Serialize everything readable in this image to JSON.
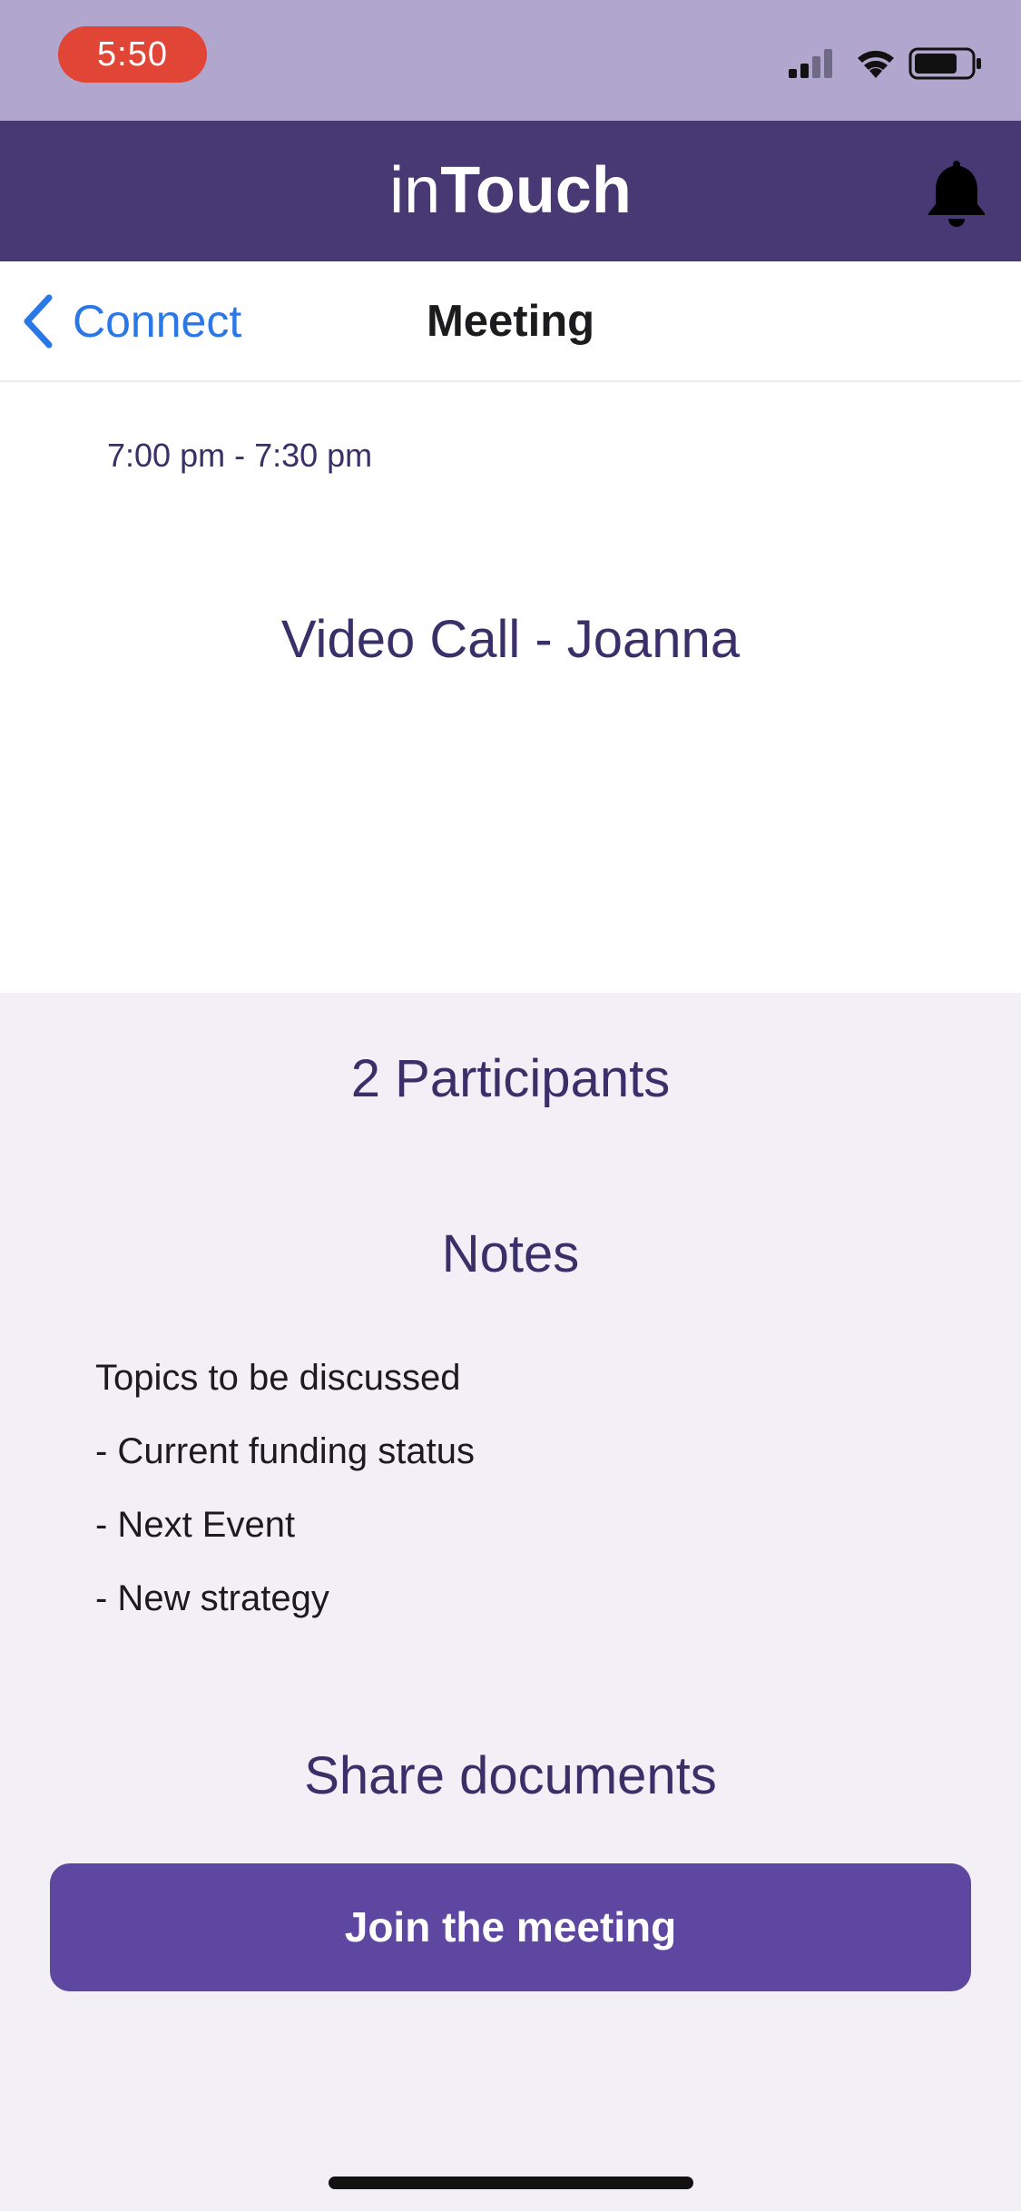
{
  "status_bar": {
    "time": "5:50",
    "icons": [
      "cellular-signal-icon",
      "wifi-icon",
      "battery-icon"
    ]
  },
  "header": {
    "brand_light": "in",
    "brand_bold": "Touch",
    "notification_icon": "bell-icon"
  },
  "nav": {
    "back_label": "Connect",
    "title": "Meeting"
  },
  "event": {
    "time_range": "7:00 pm - 7:30 pm",
    "title": "Video Call - Joanna"
  },
  "participants_label": "2 Participants",
  "notes": {
    "heading": "Notes",
    "lines": [
      "Topics to be discussed",
      "- Current funding status",
      "- Next Event",
      "- New strategy"
    ]
  },
  "share_documents_label": "Share documents",
  "join_button_label": "Join the meeting",
  "colors": {
    "status_bar": "#b0a6ce",
    "header": "#483873",
    "accent_text": "#3b2f69",
    "link": "#2a77e8",
    "button": "#5d47a0",
    "time_pill": "#e04535",
    "background": "#f2eff7"
  }
}
